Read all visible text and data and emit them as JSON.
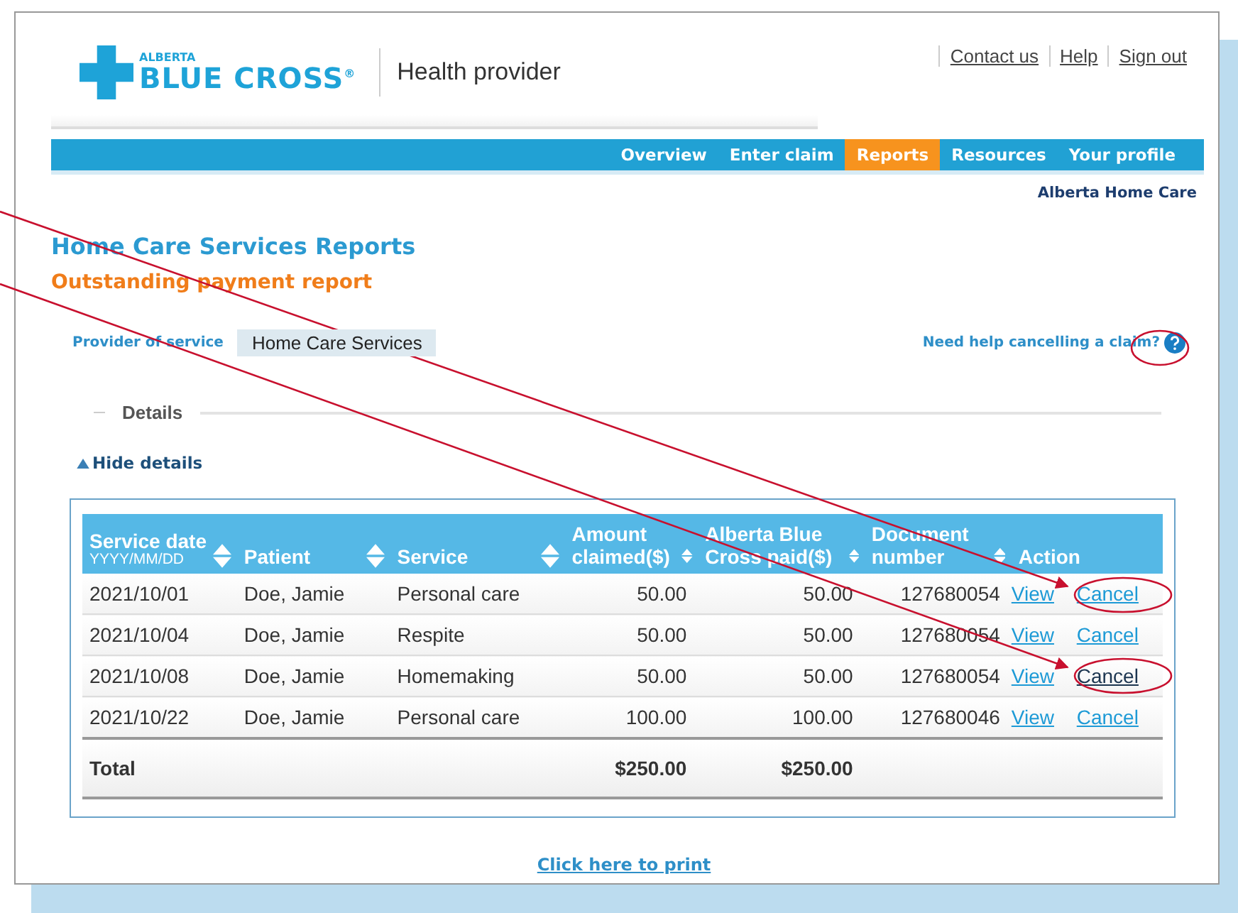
{
  "header": {
    "logo_small": "ALBERTA",
    "logo_big": "BLUE CROSS",
    "logo_mark": "®",
    "portal": "Health provider",
    "links": [
      "Contact us",
      "Help",
      "Sign out"
    ]
  },
  "nav": [
    {
      "label": "Overview",
      "selected": false
    },
    {
      "label": "Enter claim",
      "selected": false
    },
    {
      "label": "Reports",
      "selected": true
    },
    {
      "label": "Resources",
      "selected": false
    },
    {
      "label": "Your profile",
      "selected": false
    }
  ],
  "organization": "Alberta Home Care",
  "title": "Home Care Services Reports",
  "subtitle": "Outstanding payment report",
  "provider": {
    "label": "Provider of service",
    "value": "Home Care Services"
  },
  "help_link": "Need help cancelling a claim?",
  "details": {
    "legend": "Details",
    "toggle": "Hide details",
    "expanded": true
  },
  "table": {
    "columns": [
      {
        "label": "Service date",
        "sub": "YYYY/MM/DD",
        "sortable": true
      },
      {
        "label": "Patient",
        "sortable": true
      },
      {
        "label": "Service",
        "sortable": true
      },
      {
        "label": "Amount claimed($)",
        "sortable": true
      },
      {
        "label": "Alberta Blue Cross paid($)",
        "sortable": true
      },
      {
        "label": "Document number",
        "sortable": true
      },
      {
        "label": "Action",
        "sortable": false
      }
    ],
    "rows": [
      {
        "cells": [
          "2021/10/01",
          "Doe, Jamie",
          "Personal care",
          "50.00",
          "50.00",
          "127680054"
        ],
        "view": "View",
        "cancel": "Cancel",
        "cancel_hover": false
      },
      {
        "cells": [
          "2021/10/04",
          "Doe, Jamie",
          "Respite",
          "50.00",
          "50.00",
          "127680054"
        ],
        "view": "View",
        "cancel": "Cancel",
        "cancel_hover": false
      },
      {
        "cells": [
          "2021/10/08",
          "Doe, Jamie",
          "Homemaking",
          "50.00",
          "50.00",
          "127680054"
        ],
        "view": "View",
        "cancel": "Cancel",
        "cancel_hover": true
      },
      {
        "cells": [
          "2021/10/22",
          "Doe, Jamie",
          "Personal care",
          "100.00",
          "100.00",
          "127680046"
        ],
        "view": "View",
        "cancel": "Cancel",
        "cancel_hover": false
      }
    ],
    "total": {
      "label": "Total",
      "amount": "$250.00",
      "paid": "$250.00"
    }
  },
  "print_link": "Click here to print"
}
